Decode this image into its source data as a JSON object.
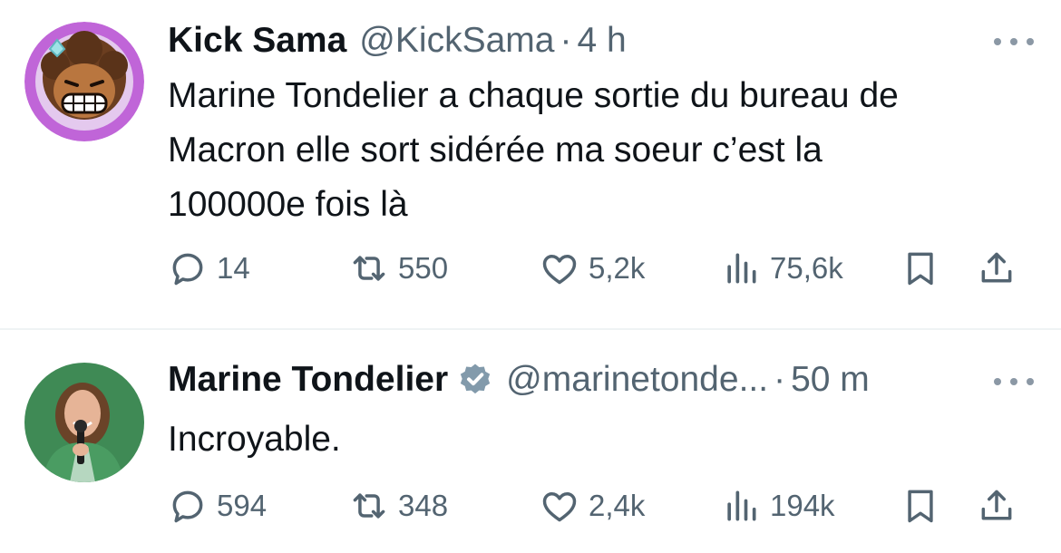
{
  "tweets": [
    {
      "author": {
        "name": "Kick Sama",
        "handle": "@KickSama",
        "verified": false
      },
      "time": "4 h",
      "text_lines": [
        "Marine Tondelier a chaque sortie du bureau de",
        "Macron elle sort sidérée ma soeur c’est la",
        "100000e fois là"
      ],
      "stats": {
        "replies": "14",
        "reposts": "550",
        "likes": "5,2k",
        "views": "75,6k"
      }
    },
    {
      "author": {
        "name": "Marine Tondelier",
        "handle": "@marinetonde...",
        "verified": true
      },
      "time": "50 m",
      "text_lines": [
        "Incroyable."
      ],
      "stats": {
        "replies": "594",
        "reposts": "348",
        "likes": "2,4k",
        "views": "194k"
      }
    }
  ],
  "separator": "·",
  "icons": {
    "reply": "reply-icon",
    "repost": "repost-icon",
    "like": "heart-icon",
    "views": "views-icon",
    "bookmark": "bookmark-icon",
    "share": "share-icon",
    "more": "more-icon",
    "verified": "verified-badge-icon"
  },
  "colors": {
    "text_primary": "#0f1419",
    "text_secondary": "#536471",
    "divider": "#eff3f4",
    "avatar_1_ring": "#c065d8",
    "avatar_2_background": "#3f8a55"
  }
}
